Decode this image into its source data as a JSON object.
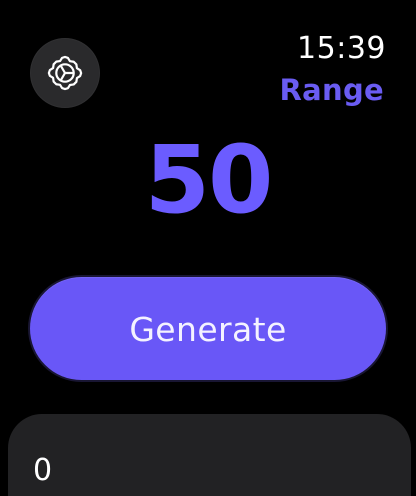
{
  "header": {
    "time": "15:39",
    "mode": "Range"
  },
  "main": {
    "result": "50",
    "generate_label": "Generate"
  },
  "field": {
    "value": "0"
  },
  "icons": {
    "settings": "gear-icon"
  },
  "colors": {
    "background": "#000000",
    "accent": "#6b5cff",
    "button": "#6957f7",
    "panel": "#222224",
    "text": "#ffffff"
  }
}
